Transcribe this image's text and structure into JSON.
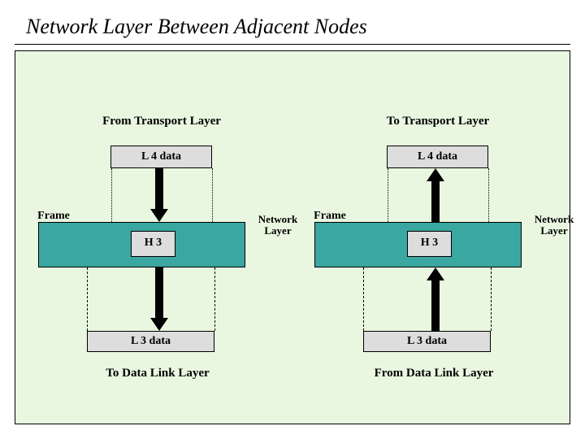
{
  "title": "Network Layer Between Adjacent Nodes",
  "left": {
    "top_label": "From Transport Layer",
    "l4_label": "L 4 data",
    "frame_label": "Frame",
    "h3_label": "H 3",
    "nl_label_line1": "Network",
    "nl_label_line2": "Layer",
    "l3_label": "L 3 data",
    "bottom_label": "To Data Link Layer"
  },
  "right": {
    "top_label": "To Transport Layer",
    "l4_label": "L 4 data",
    "frame_label": "Frame",
    "h3_label": "H 3",
    "nl_label_line1": "Network",
    "nl_label_line2": "Layer",
    "l3_label": "L 3 data",
    "bottom_label": "From Data Link Layer"
  }
}
